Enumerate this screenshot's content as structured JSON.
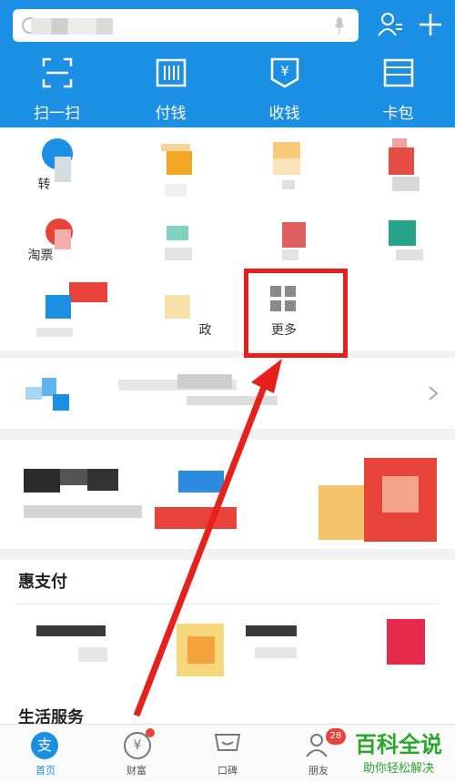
{
  "quick_actions": [
    {
      "label": "扫一扫",
      "icon": "scan-icon"
    },
    {
      "label": "付钱",
      "icon": "barcode-icon"
    },
    {
      "label": "收钱",
      "icon": "receive-money-icon"
    },
    {
      "label": "卡包",
      "icon": "card-wallet-icon"
    }
  ],
  "grid": {
    "item_r1c1_label": "转",
    "item_r2c1_label": "淘票",
    "item_r3c2_label": "政",
    "more_label": "更多"
  },
  "sections": {
    "hui_title": "惠支付",
    "life_title": "生活服务"
  },
  "tabbar": {
    "tabs": [
      {
        "label": "首页",
        "icon": "alipay-home-icon"
      },
      {
        "label": "财富",
        "icon": "yuan-coin-icon"
      },
      {
        "label": "口碑",
        "icon": "koubei-icon"
      },
      {
        "label": "朋友",
        "icon": "friends-icon"
      }
    ],
    "friends_badge": "28"
  },
  "watermark": {
    "title": "百科全说",
    "subtitle": "助你轻松解决"
  },
  "colors": {
    "header_blue": "#1b8fe4",
    "annotation_red": "#e8201c",
    "watermark_green": "#2aa62a"
  }
}
